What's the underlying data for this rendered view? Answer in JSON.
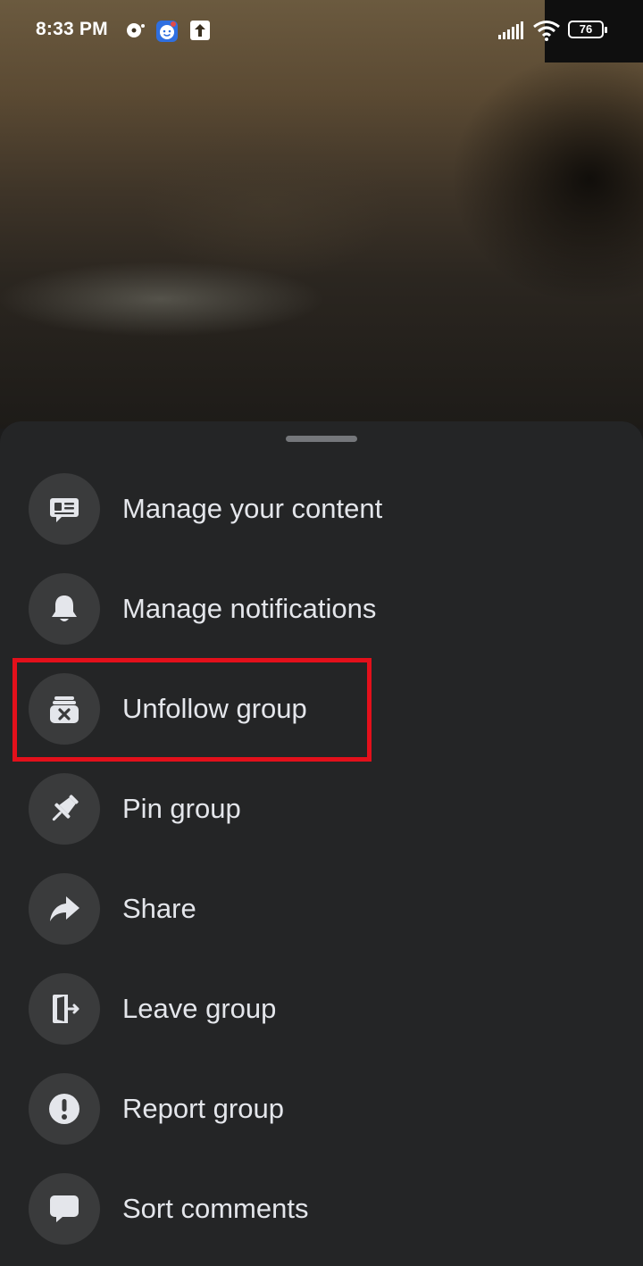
{
  "status_bar": {
    "time": "8:33 PM",
    "battery": "76"
  },
  "menu": {
    "items": [
      {
        "label": "Manage your content",
        "icon": "manage-content-icon"
      },
      {
        "label": "Manage notifications",
        "icon": "bell-icon"
      },
      {
        "label": "Unfollow group",
        "icon": "unfollow-icon"
      },
      {
        "label": "Pin group",
        "icon": "pin-icon"
      },
      {
        "label": "Share",
        "icon": "share-icon"
      },
      {
        "label": "Leave group",
        "icon": "leave-icon"
      },
      {
        "label": "Report group",
        "icon": "report-icon"
      },
      {
        "label": "Sort comments",
        "icon": "comment-icon"
      }
    ]
  },
  "colors": {
    "sheet_bg": "#242526",
    "icon_circle": "#3a3b3c",
    "text": "#e4e6eb",
    "highlight": "#e3101b"
  }
}
